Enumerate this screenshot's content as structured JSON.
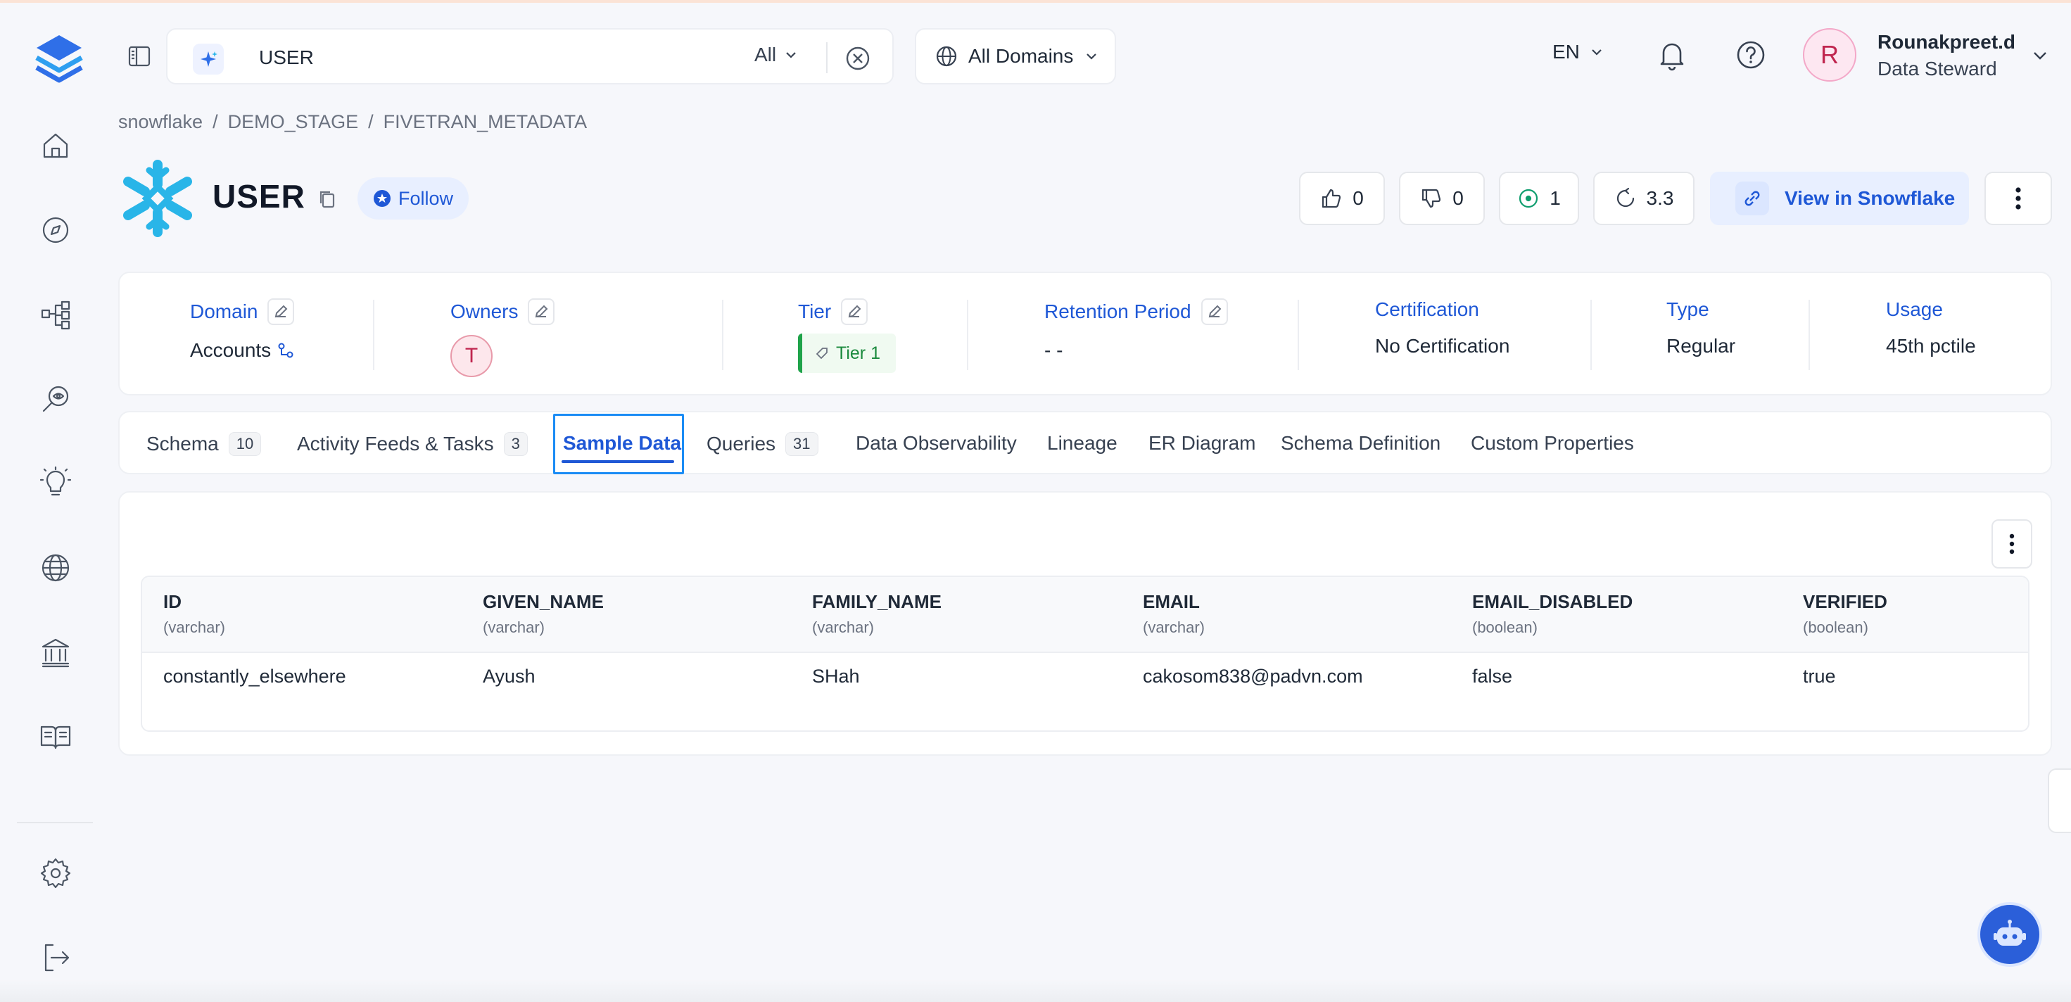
{
  "header": {
    "search": {
      "value": "USER",
      "scope": "All"
    },
    "domain_filter": "All Domains",
    "language": "EN",
    "user": {
      "initial": "R",
      "name": "Rounakpreet.d",
      "role": "Data Steward"
    }
  },
  "breadcrumb": [
    "snowflake",
    "DEMO_STAGE",
    "FIVETRAN_METADATA"
  ],
  "breadcrumb_sep": "/",
  "entity": {
    "title": "USER",
    "follow_label": "Follow",
    "stats": {
      "upvotes": "0",
      "downvotes": "0",
      "tasks": "1",
      "version": "3.3"
    },
    "view_label": "View in Snowflake"
  },
  "properties": {
    "domain": {
      "label": "Domain",
      "value": "Accounts"
    },
    "owners": {
      "label": "Owners",
      "avatar_initial": "T"
    },
    "tier": {
      "label": "Tier",
      "value": "Tier 1"
    },
    "retention": {
      "label": "Retention Period",
      "value": "- -"
    },
    "certification": {
      "label": "Certification",
      "value": "No Certification"
    },
    "type": {
      "label": "Type",
      "value": "Regular"
    },
    "usage": {
      "label": "Usage",
      "value": "45th pctile"
    }
  },
  "tabs": [
    {
      "label": "Schema",
      "count": "10"
    },
    {
      "label": "Activity Feeds & Tasks",
      "count": "3"
    },
    {
      "label": "Sample Data",
      "count": ""
    },
    {
      "label": "Queries",
      "count": "31"
    },
    {
      "label": "Data Observability",
      "count": ""
    },
    {
      "label": "Lineage",
      "count": ""
    },
    {
      "label": "ER Diagram",
      "count": ""
    },
    {
      "label": "Schema Definition",
      "count": ""
    },
    {
      "label": "Custom Properties",
      "count": ""
    }
  ],
  "sample_data": {
    "columns": [
      {
        "name": "ID",
        "type": "(varchar)"
      },
      {
        "name": "GIVEN_NAME",
        "type": "(varchar)"
      },
      {
        "name": "FAMILY_NAME",
        "type": "(varchar)"
      },
      {
        "name": "EMAIL",
        "type": "(varchar)"
      },
      {
        "name": "EMAIL_DISABLED",
        "type": "(boolean)"
      },
      {
        "name": "VERIFIED",
        "type": "(boolean)"
      }
    ],
    "rows": [
      [
        "constantly_elsewhere",
        "Ayush",
        "SHah",
        "cakosom838@padvn.com",
        "false",
        "true"
      ]
    ]
  },
  "colors": {
    "accent": "#1f58d6",
    "snowflake": "#29b5e8",
    "tier_green": "#1fa34a",
    "focus": "#1b8cf5"
  },
  "icons": {
    "sidebar": [
      "home-icon",
      "explore-icon",
      "lineage-icon",
      "observability-icon",
      "insights-icon",
      "domains-icon",
      "governance-icon",
      "glossary-icon",
      "settings-icon",
      "logout-icon"
    ]
  }
}
